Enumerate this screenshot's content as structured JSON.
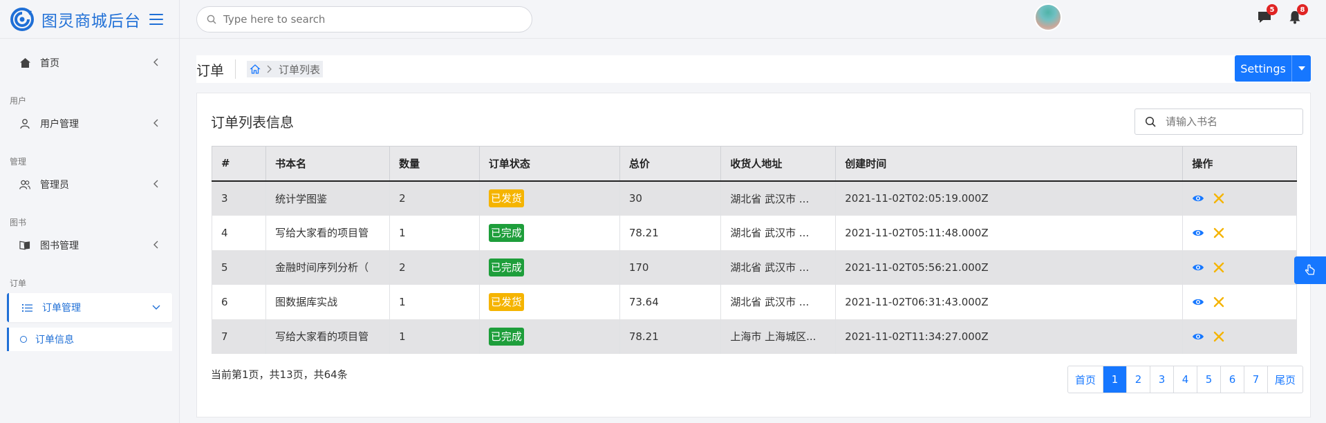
{
  "brand": {
    "title": "图灵商城后台"
  },
  "search": {
    "placeholder": "Type here to search"
  },
  "header": {
    "messages_badge": "5",
    "notifications_badge": "8"
  },
  "sidebar": {
    "home": "首页",
    "sections": {
      "user": "用户",
      "admin": "管理",
      "book": "图书",
      "order": "订单"
    },
    "items": {
      "user_mgmt": "用户管理",
      "admin_mgmt": "管理员",
      "book_mgmt": "图书管理",
      "order_mgmt": "订单管理",
      "order_info": "订单信息"
    }
  },
  "page": {
    "title": "订单",
    "breadcrumb": "订单列表",
    "settings_label": "Settings"
  },
  "card": {
    "title": "订单列表信息",
    "search_placeholder": "请输入书名"
  },
  "table": {
    "headers": [
      "#",
      "书本名",
      "数量",
      "订单状态",
      "总价",
      "收货人地址",
      "创建时间",
      "操作"
    ],
    "rows": [
      {
        "id": "3",
        "book": "统计学图鉴",
        "qty": "2",
        "status": "已发货",
        "status_color": "#f5b400",
        "total": "30",
        "address": "湖北省 武汉市 ...",
        "created": "2021-11-02T02:05:19.000Z"
      },
      {
        "id": "4",
        "book": "写给大家看的项目管",
        "qty": "1",
        "status": "已完成",
        "status_color": "#1e9e3b",
        "total": "78.21",
        "address": "湖北省 武汉市 ...",
        "created": "2021-11-02T05:11:48.000Z"
      },
      {
        "id": "5",
        "book": "金融时间序列分析（",
        "qty": "2",
        "status": "已完成",
        "status_color": "#1e9e3b",
        "total": "170",
        "address": "湖北省 武汉市 ...",
        "created": "2021-11-02T05:56:21.000Z"
      },
      {
        "id": "6",
        "book": "图数据库实战",
        "qty": "1",
        "status": "已发货",
        "status_color": "#f5b400",
        "total": "73.64",
        "address": "湖北省 武汉市 ...",
        "created": "2021-11-02T06:31:43.000Z"
      },
      {
        "id": "7",
        "book": "写给大家看的项目管",
        "qty": "1",
        "status": "已完成",
        "status_color": "#1e9e3b",
        "total": "78.21",
        "address": "上海市 上海城区...",
        "created": "2021-11-02T11:34:27.000Z"
      }
    ]
  },
  "summary": "当前第1页，共13页，共64条",
  "pagination": {
    "first": "首页",
    "pages": [
      "1",
      "2",
      "3",
      "4",
      "5",
      "6",
      "7"
    ],
    "current": "1",
    "last": "尾页"
  },
  "colors": {
    "accent": "#1677ff",
    "brand": "#1f6fd6",
    "shipped": "#f5b400",
    "completed": "#1e9e3b",
    "badge": "#e02424"
  },
  "icons": {
    "brand_logo": "swirl-logo-icon",
    "menu": "hamburger-icon",
    "search": "search-icon",
    "messages": "chat-icon",
    "notifications": "bell-icon",
    "home": "home-icon",
    "user": "user-icon",
    "admin": "users-icon",
    "book": "book-icon",
    "order": "list-icon",
    "view": "eye-icon",
    "delete": "close-icon",
    "floating": "hand-pointer-icon"
  }
}
